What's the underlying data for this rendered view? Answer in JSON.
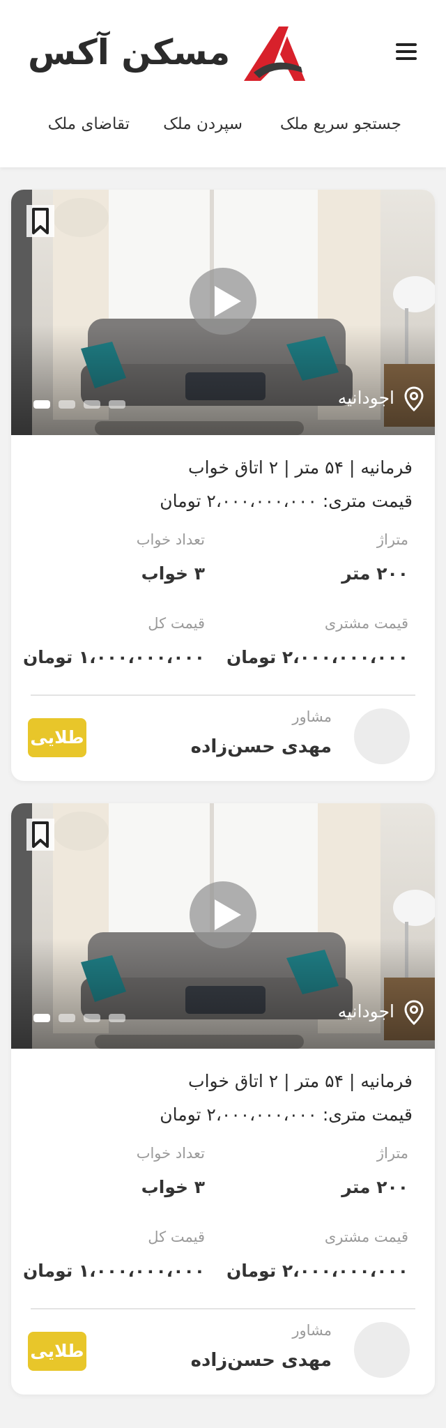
{
  "header": {
    "brand": "مسکن آکس",
    "nav": [
      "جستجو سریع ملک",
      "سپردن ملک",
      "تقاضای ملک"
    ]
  },
  "colors": {
    "accent_red": "#d8212b",
    "badge_gold": "#e8c62a",
    "page_bg": "#f2f2f2"
  },
  "icons": [
    "menu-icon",
    "logo-icon",
    "bookmark-icon",
    "play-icon",
    "location-pin-icon"
  ],
  "listings": [
    {
      "location": "اجودانیه",
      "summary": "فرمانیه  |  ۵۴ متر  |  ۲ اتاق خواب",
      "price_per_meter": "قیمت متری: ۲،۰۰۰،۰۰۰،۰۰۰ تومان",
      "area_label": "متراژ",
      "area_value": "۲۰۰ متر",
      "bedrooms_label": "تعداد خواب",
      "bedrooms_value": "۳ خواب",
      "customer_price_label": "قیمت مشتری",
      "customer_price_value": "۲،۰۰۰،۰۰۰،۰۰۰ تومان",
      "total_price_label": "قیمت کل",
      "total_price_value": "۱،۰۰۰،۰۰۰،۰۰۰ تومان",
      "advisor_label": "مشاور",
      "advisor_name": "مهدی حسن‌زاده",
      "badge": "طلایی",
      "slides": 4,
      "active_slide": 1
    },
    {
      "location": "اجودانیه",
      "summary": "فرمانیه  |  ۵۴ متر  |  ۲ اتاق خواب",
      "price_per_meter": "قیمت متری: ۲،۰۰۰،۰۰۰،۰۰۰ تومان",
      "area_label": "متراژ",
      "area_value": "۲۰۰ متر",
      "bedrooms_label": "تعداد خواب",
      "bedrooms_value": "۳ خواب",
      "customer_price_label": "قیمت مشتری",
      "customer_price_value": "۲،۰۰۰،۰۰۰،۰۰۰ تومان",
      "total_price_label": "قیمت کل",
      "total_price_value": "۱،۰۰۰،۰۰۰،۰۰۰ تومان",
      "advisor_label": "مشاور",
      "advisor_name": "مهدی حسن‌زاده",
      "badge": "طلایی",
      "slides": 4,
      "active_slide": 1
    }
  ]
}
